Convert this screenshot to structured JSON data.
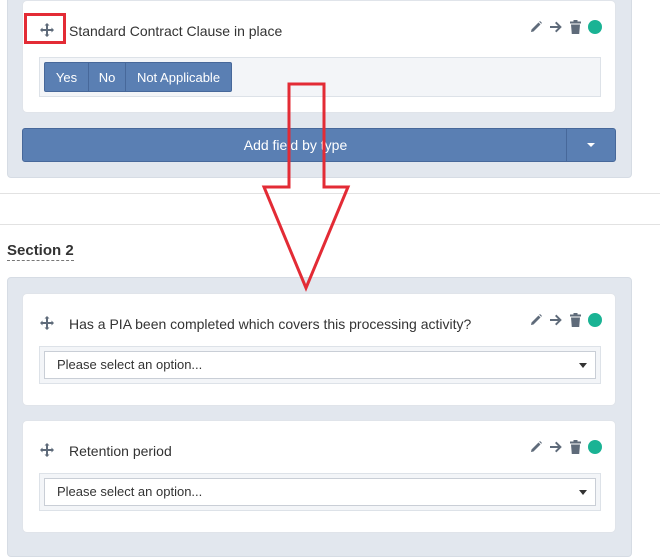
{
  "section1": {
    "field": {
      "title": "Standard Contract Clause in place",
      "options": [
        "Yes",
        "No",
        "Not Applicable"
      ]
    },
    "add_field_label": "Add field by type"
  },
  "section2": {
    "title": "Section 2",
    "fields": [
      {
        "title": "Has a PIA been completed which covers this processing activity?",
        "placeholder": "Please select an option..."
      },
      {
        "title": "Retention period",
        "placeholder": "Please select an option..."
      }
    ]
  },
  "icons": {
    "move": "move-icon",
    "edit": "pencil-icon",
    "go": "arrow-right-icon",
    "delete": "trash-icon",
    "status": "status-dot-icon"
  },
  "colors": {
    "accent_blue": "#5a7fb3",
    "status_green": "#1ab394",
    "annotation_red": "#e32b35"
  }
}
